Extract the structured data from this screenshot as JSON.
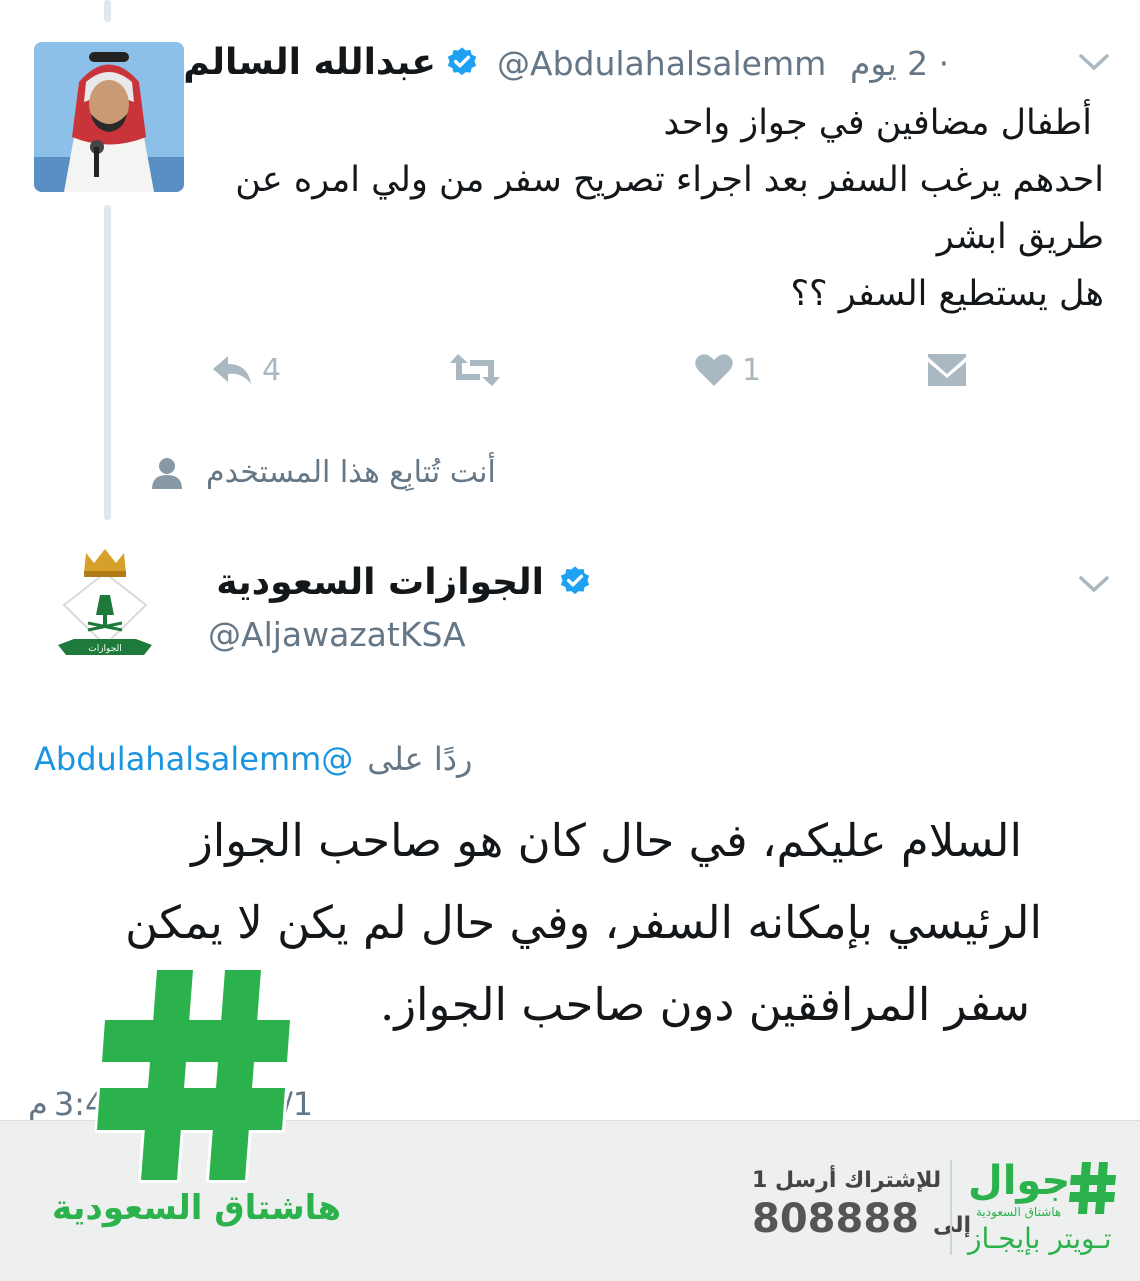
{
  "tweet1": {
    "name": "عبدالله السالم",
    "handle": "@Abdulahalsalemm",
    "time": "· 2 يوم",
    "lines": [
      "أطفال مضافين في جواز واحد",
      "احدهم يرغب السفر بعد اجراء تصريح سفر من ولي امره عن",
      "طريق ابشر",
      "هل يستطيع السفر ؟؟"
    ],
    "reply_count": "4",
    "like_count": "1",
    "follow_note": "أنت تُتابِع هذا المستخدم"
  },
  "tweet2": {
    "name": "الجوازات السعودية",
    "handle": "@AljawazatKSA",
    "reply_to_prefix": "ردًا على",
    "reply_to_handle": "Abdulahalsalemm@",
    "lines": [
      "السلام عليكم، في حال كان هو صاحب الجواز",
      "الرئيسي بإمكانه السفر، وفي حال لم يكن لا يمكن",
      "سفر المرافقين دون صاحب الجواز."
    ],
    "timestamp_partial_left": "3:4",
    "timestamp_suffix": "م",
    "timestamp_partial_right": "/1"
  },
  "overlay": {
    "hashtag_caption": "هاشتاق السعودية",
    "brand_name": "جوال",
    "brand_sub": "هاشتاق السعودية",
    "brand_tagline": "تـويتر بإيجـاز",
    "subscribe_line": "للإشتراك أرسل 1",
    "to_label": "إلى",
    "number": "808888"
  },
  "colors": {
    "verified": "#1da1f2",
    "action_gray": "#aab8c2",
    "mention_blue": "#1b95e0",
    "brand_green": "#2bb24c"
  },
  "icons": [
    "chevron-down-icon",
    "verified-icon",
    "reply-icon",
    "retweet-icon",
    "like-icon",
    "dm-icon",
    "person-icon",
    "hashtag-icon"
  ]
}
